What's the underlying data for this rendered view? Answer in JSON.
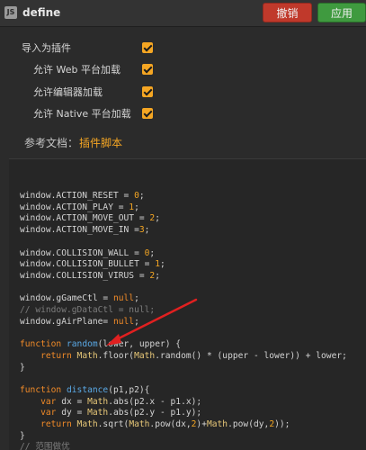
{
  "window": {
    "icon_text": "JS",
    "title": "define"
  },
  "buttons": {
    "cancel": "撤销",
    "apply": "应用"
  },
  "settings": [
    {
      "label": "导入为插件",
      "checked": true
    },
    {
      "label": "允许 Web 平台加载",
      "checked": true
    },
    {
      "label": "允许编辑器加载",
      "checked": true
    },
    {
      "label": "允许 Native 平台加载",
      "checked": true
    }
  ],
  "reference": {
    "label": "参考文档：",
    "link": "插件脚本"
  },
  "colors": {
    "accent": "#f5a623",
    "cancel": "#c0392b",
    "apply": "#3f9a3f",
    "annotation_arrow": "#e02020"
  }
}
